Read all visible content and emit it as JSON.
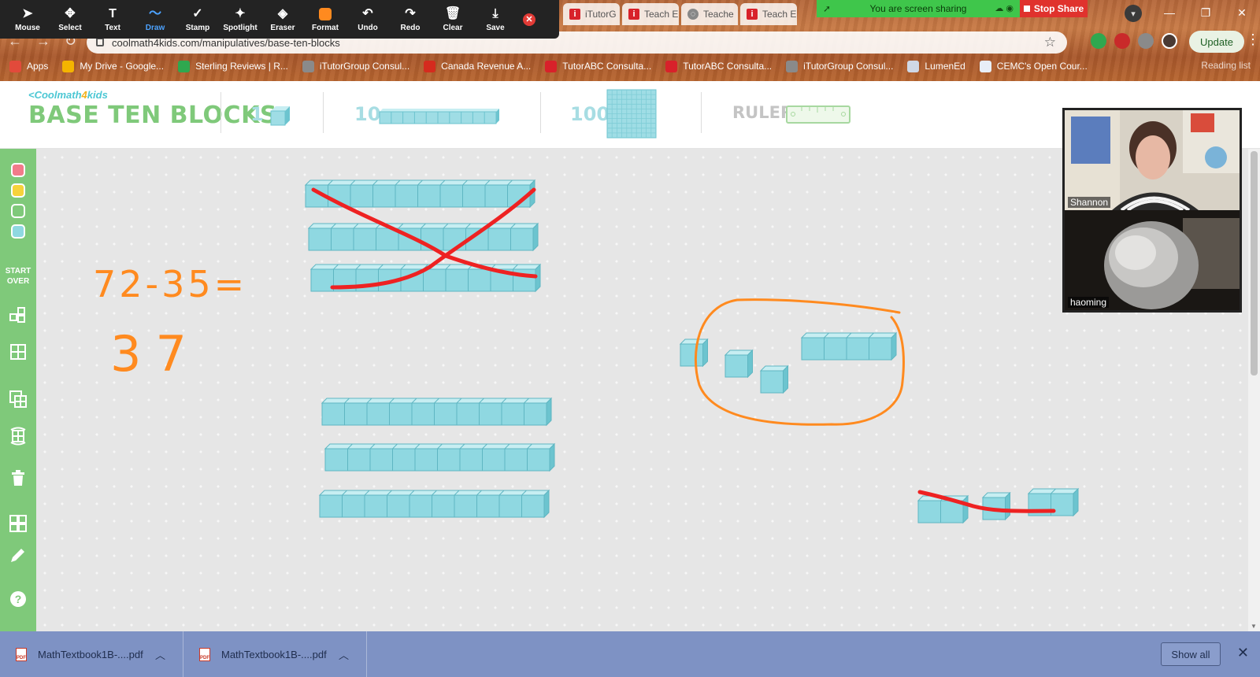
{
  "zoom_toolbar": {
    "tools": [
      {
        "label": "Mouse",
        "icon": "cursor-icon",
        "glyph": "➤"
      },
      {
        "label": "Select",
        "icon": "move-icon",
        "glyph": "✥"
      },
      {
        "label": "Text",
        "icon": "text-icon",
        "glyph": "T"
      },
      {
        "label": "Draw",
        "icon": "draw-icon",
        "glyph": "〜"
      },
      {
        "label": "Stamp",
        "icon": "check-stamp-icon",
        "glyph": "✓"
      },
      {
        "label": "Spotlight",
        "icon": "spotlight-wand-icon",
        "glyph": "✦"
      },
      {
        "label": "Eraser",
        "icon": "eraser-icon",
        "glyph": "◈"
      },
      {
        "label": "Format",
        "icon": "format-color-icon",
        "glyph": ""
      },
      {
        "label": "Undo",
        "icon": "undo-icon",
        "glyph": "↶"
      },
      {
        "label": "Redo",
        "icon": "redo-icon",
        "glyph": "↷"
      },
      {
        "label": "Clear",
        "icon": "trash-icon",
        "glyph": "🗑"
      },
      {
        "label": "Save",
        "icon": "save-download-icon",
        "glyph": "⤓"
      }
    ],
    "active": "Draw",
    "format_color": "#ff8a1f",
    "close_glyph": "✕"
  },
  "browser": {
    "tabs": [
      {
        "label": "iTutorG",
        "fav": "i"
      },
      {
        "label": "Teach E",
        "fav": "i"
      },
      {
        "label": "Teache",
        "fav": "◌"
      },
      {
        "label": "Teach E",
        "fav": "i"
      }
    ],
    "share_banner": "You are screen sharing",
    "stop_share": "Stop Share",
    "url": "coolmath4kids.com/manipulatives/base-ten-blocks",
    "update_button": "Update",
    "bookmarks": [
      {
        "label": "Apps",
        "color": "#e24a3b"
      },
      {
        "label": "My Drive - Google...",
        "color": "#f4b400"
      },
      {
        "label": "Sterling Reviews | R...",
        "color": "#2fa84f"
      },
      {
        "label": "iTutorGroup Consul...",
        "color": "#8a8a8a"
      },
      {
        "label": "Canada Revenue A...",
        "color": "#d52b1e"
      },
      {
        "label": "TutorABC Consulta...",
        "color": "#d8212a"
      },
      {
        "label": "TutorABC Consulta...",
        "color": "#d8212a"
      },
      {
        "label": "iTutorGroup Consul...",
        "color": "#8a8a8a"
      },
      {
        "label": "LumenEd",
        "color": "#cfd8e6"
      },
      {
        "label": "CEMC's Open Cour...",
        "color": "#e8eef7"
      }
    ],
    "reading_list": "Reading list"
  },
  "app": {
    "brand_cool": "Coolmath",
    "brand_four": "4",
    "brand_kids": "kids",
    "back_glyph": "<",
    "title": "BASE TEN BLOCKS",
    "block_labels": [
      "1",
      "10",
      "100"
    ],
    "ruler_label": "RULER",
    "brand_color": "#7fc97a",
    "block_color": "#8fd8e1"
  },
  "sidebar": {
    "colors": [
      "#f27b8a",
      "#f7d23b",
      "#7fc97a",
      "#8fd8e1"
    ],
    "start_over": [
      "START",
      "OVER"
    ]
  },
  "board": {
    "equation": "72-35=",
    "answer": "37",
    "ink_orange": "#ff8a1f",
    "ink_red": "#ee2222"
  },
  "video": {
    "participants": [
      "Shannon",
      "haoming"
    ]
  },
  "downloads": {
    "files": [
      "MathTextbook1B-....pdf",
      "MathTextbook1B-....pdf"
    ],
    "show_all": "Show all"
  }
}
